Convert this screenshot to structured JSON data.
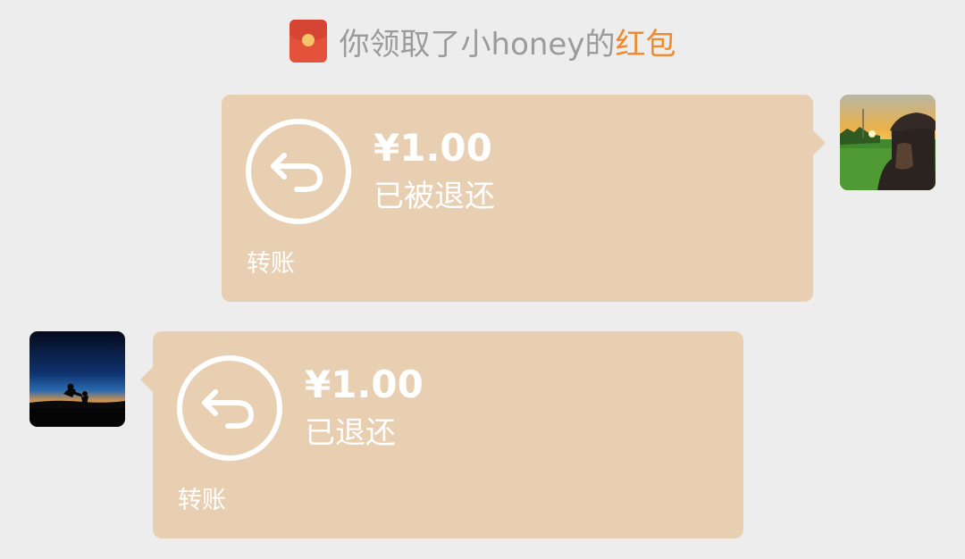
{
  "notice": {
    "text": "你领取了小honey的",
    "highlight": "红包",
    "highlight_color": "#f08a2c",
    "icon": "red-envelope-icon"
  },
  "messages": [
    {
      "side": "right",
      "amount": "¥1.00",
      "status": "已被退还",
      "type_label": "转账",
      "icon": "return-arrow-icon",
      "avatar": "sunset-field-avatar"
    },
    {
      "side": "left",
      "amount": "¥1.00",
      "status": "已退还",
      "type_label": "转账",
      "icon": "return-arrow-icon",
      "avatar": "dusk-silhouette-avatar"
    }
  ],
  "colors": {
    "background": "#ededed",
    "bubble": "#e8cfb2",
    "text_on_bubble": "#ffffff"
  }
}
